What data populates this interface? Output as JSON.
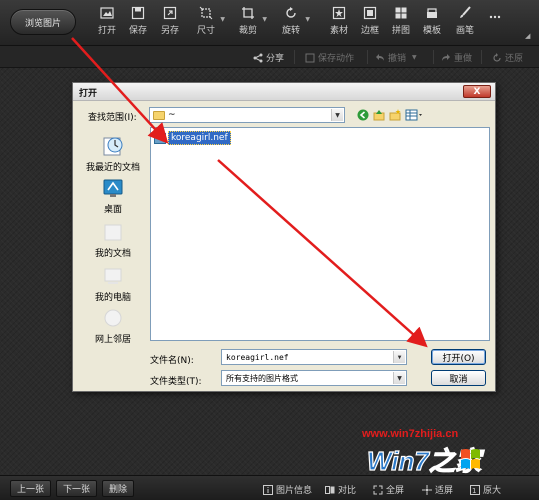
{
  "app": {
    "browse_label": "浏览图片",
    "tools": [
      {
        "label": "打开",
        "icon": "open-image-icon"
      },
      {
        "label": "保存",
        "icon": "save-icon"
      },
      {
        "label": "另存",
        "icon": "save-as-icon"
      },
      {
        "label": "尺寸",
        "icon": "resize-icon"
      },
      {
        "label": "裁剪",
        "icon": "crop-icon"
      },
      {
        "label": "旋转",
        "icon": "rotate-icon"
      },
      {
        "label": "素材",
        "icon": "sticker-icon"
      },
      {
        "label": "边框",
        "icon": "border-icon"
      },
      {
        "label": "拼图",
        "icon": "collage-icon"
      },
      {
        "label": "模板",
        "icon": "template-icon"
      },
      {
        "label": "画笔",
        "icon": "brush-icon"
      }
    ],
    "more_icon": "more-dots-icon",
    "actions": {
      "share": "分享",
      "save_action": "保存动作",
      "undo": "撤销",
      "redo": "重做",
      "restore": "还原"
    },
    "bottom": {
      "prev": "上一张",
      "next": "下一张",
      "delete": "删除",
      "image_info": "图片信息",
      "compare": "对比",
      "fullscreen": "全屏",
      "fit": "适屏",
      "original": "原大"
    }
  },
  "dialog": {
    "title": "打开",
    "close": "X",
    "look_in_label": "查找范围(I):",
    "look_in_value": "~",
    "places": [
      {
        "label": "我最近的文档",
        "icon": "recent-docs-icon"
      },
      {
        "label": "桌面",
        "icon": "desktop-icon"
      },
      {
        "label": "我的文档",
        "icon": "my-documents-icon"
      },
      {
        "label": "我的电脑",
        "icon": "my-computer-icon"
      },
      {
        "label": "网上邻居",
        "icon": "network-icon"
      }
    ],
    "files": [
      {
        "name": "koreagirl.nef",
        "selected": true
      }
    ],
    "filename_label": "文件名(N):",
    "filename_value": "koreagirl.nef",
    "filetype_label": "文件类型(T):",
    "filetype_value": "所有支持的图片格式",
    "open_button": "打开(O)",
    "cancel_button": "取消"
  },
  "watermark": {
    "url": "www.win7zhijia.cn",
    "logo_text": "Win7之家"
  },
  "colors": {
    "arrow": "#e21d1d",
    "selection": "#316ac5",
    "dialog_bg": "#ece9d8"
  }
}
